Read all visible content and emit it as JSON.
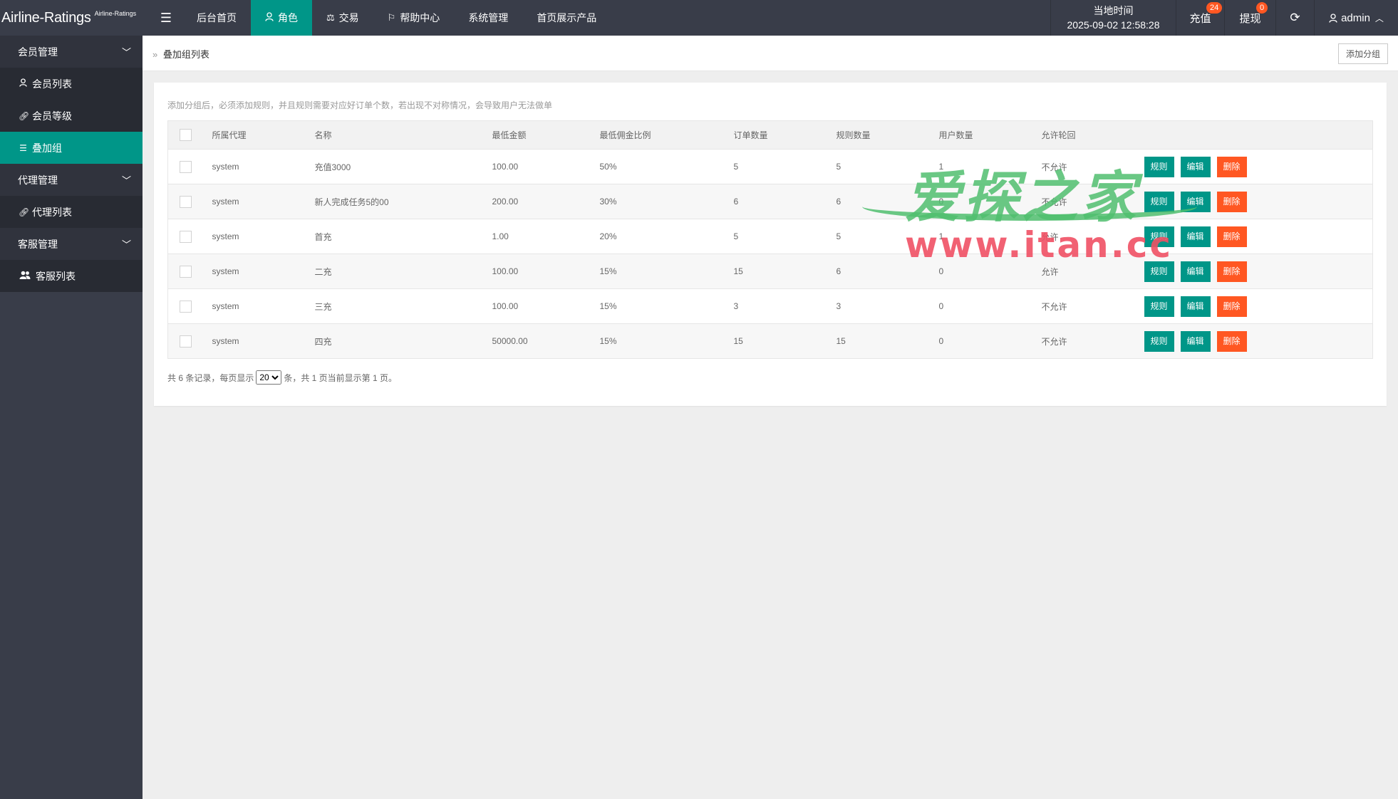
{
  "app": {
    "title": "Airline-Ratings",
    "subtitle": "Airline-Ratings"
  },
  "nav": [
    {
      "label": "后台首页",
      "icon": ""
    },
    {
      "label": "角色",
      "icon": "user-icon",
      "active": true
    },
    {
      "label": "交易",
      "icon": "scale-icon"
    },
    {
      "label": "帮助中心",
      "icon": "flag-icon"
    },
    {
      "label": "系统管理",
      "icon": ""
    },
    {
      "label": "首页展示产品",
      "icon": ""
    }
  ],
  "topright": {
    "time_label": "当地时间",
    "time_value": "2025-09-02 12:58:28",
    "recharge_label": "充值",
    "recharge_count": "24",
    "withdraw_label": "提现",
    "withdraw_count": "0",
    "user": "admin"
  },
  "sidebar": {
    "groups": [
      {
        "label": "会员管理",
        "items": [
          {
            "label": "会员列表",
            "icon": "user-icon"
          },
          {
            "label": "会员等级",
            "icon": "link-icon"
          },
          {
            "label": "叠加组",
            "icon": "list-icon",
            "active": true
          }
        ]
      },
      {
        "label": "代理管理",
        "items": [
          {
            "label": "代理列表",
            "icon": "link-icon"
          }
        ]
      },
      {
        "label": "客服管理",
        "items": [
          {
            "label": "客服列表",
            "icon": "users-icon"
          }
        ]
      }
    ]
  },
  "breadcrumb": {
    "current": "叠加组列表"
  },
  "add_group_label": "添加分组",
  "tip": "添加分组后，必须添加规则，并且规则需要对应好订单个数，若出现不对称情况，会导致用户无法做单",
  "table": {
    "headers": [
      "所属代理",
      "名称",
      "最低金额",
      "最低佣金比例",
      "订单数量",
      "规则数量",
      "用户数量",
      "允许轮回"
    ],
    "rows": [
      [
        "system",
        "充值3000",
        "100.00",
        "50%",
        "5",
        "5",
        "1",
        "不允许"
      ],
      [
        "system",
        "新人完成任务5的00",
        "200.00",
        "30%",
        "6",
        "6",
        "0",
        "不允许"
      ],
      [
        "system",
        "首充",
        "1.00",
        "20%",
        "5",
        "5",
        "1",
        "允许"
      ],
      [
        "system",
        "二充",
        "100.00",
        "15%",
        "15",
        "6",
        "0",
        "允许"
      ],
      [
        "system",
        "三充",
        "100.00",
        "15%",
        "3",
        "3",
        "0",
        "不允许"
      ],
      [
        "system",
        "四充",
        "50000.00",
        "15%",
        "15",
        "15",
        "0",
        "不允许"
      ]
    ],
    "actions": {
      "rule": "规则",
      "edit": "编辑",
      "delete": "删除"
    }
  },
  "pager": {
    "prefix": "共 6 条记录，每页显示",
    "page_size": "20",
    "suffix": "条，共 1 页当前显示第 1 页。"
  },
  "watermark": {
    "cn": "爱探之家",
    "url": "www.itan.cc"
  }
}
